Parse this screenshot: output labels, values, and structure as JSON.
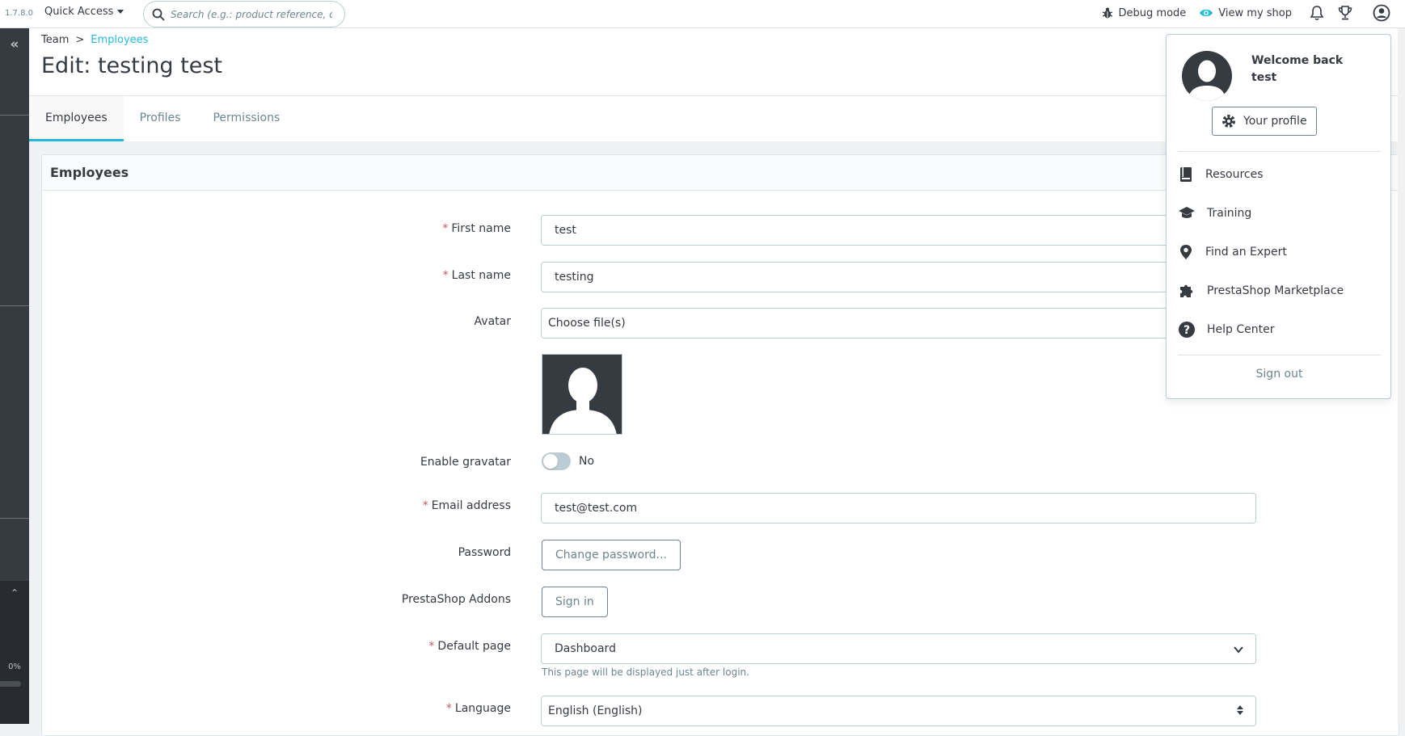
{
  "topbar": {
    "version": "1.7.8.0",
    "quick_access": "Quick Access",
    "search_placeholder": "Search (e.g.: product reference, custon",
    "debug_mode": "Debug mode",
    "view_shop": "View my shop"
  },
  "sidebar": {
    "progress_text": "0%",
    "progress": 0
  },
  "header": {
    "breadcrumb": [
      "Team",
      ">",
      "Employees"
    ],
    "title": "Edit: testing test",
    "tabs": [
      {
        "label": "Employees",
        "active": true
      },
      {
        "label": "Profiles",
        "active": false
      },
      {
        "label": "Permissions",
        "active": false
      }
    ]
  },
  "card": {
    "title": "Employees"
  },
  "form": {
    "first_name_label": "First name",
    "first_name_value": "test",
    "last_name_label": "Last name",
    "last_name_value": "testing",
    "avatar_label": "Avatar",
    "avatar_choose": "Choose file(s)",
    "gravatar_label": "Enable gravatar",
    "gravatar_state": "No",
    "email_label": "Email address",
    "email_value": "test@test.com",
    "password_label": "Password",
    "password_button": "Change password...",
    "addons_label": "PrestaShop Addons",
    "addons_button": "Sign in",
    "default_page_label": "Default page",
    "default_page_value": "Dashboard",
    "default_page_help": "This page will be displayed just after login.",
    "language_label": "Language",
    "language_value": "English (English)",
    "required_mark": "*"
  },
  "user_menu": {
    "welcome": "Welcome back",
    "username": "test",
    "your_profile": "Your profile",
    "items": [
      {
        "label": "Resources",
        "icon": "book-icon"
      },
      {
        "label": "Training",
        "icon": "graduation-cap-icon"
      },
      {
        "label": "Find an Expert",
        "icon": "map-pin-icon"
      },
      {
        "label": "PrestaShop Marketplace",
        "icon": "puzzle-icon"
      },
      {
        "label": "Help Center",
        "icon": "help-circle-icon"
      }
    ],
    "sign_out": "Sign out"
  },
  "colors": {
    "accent": "#25b9d7",
    "text": "#363a41",
    "muted": "#6c868e",
    "sidebar": "#363a41",
    "required": "#c05c67"
  }
}
